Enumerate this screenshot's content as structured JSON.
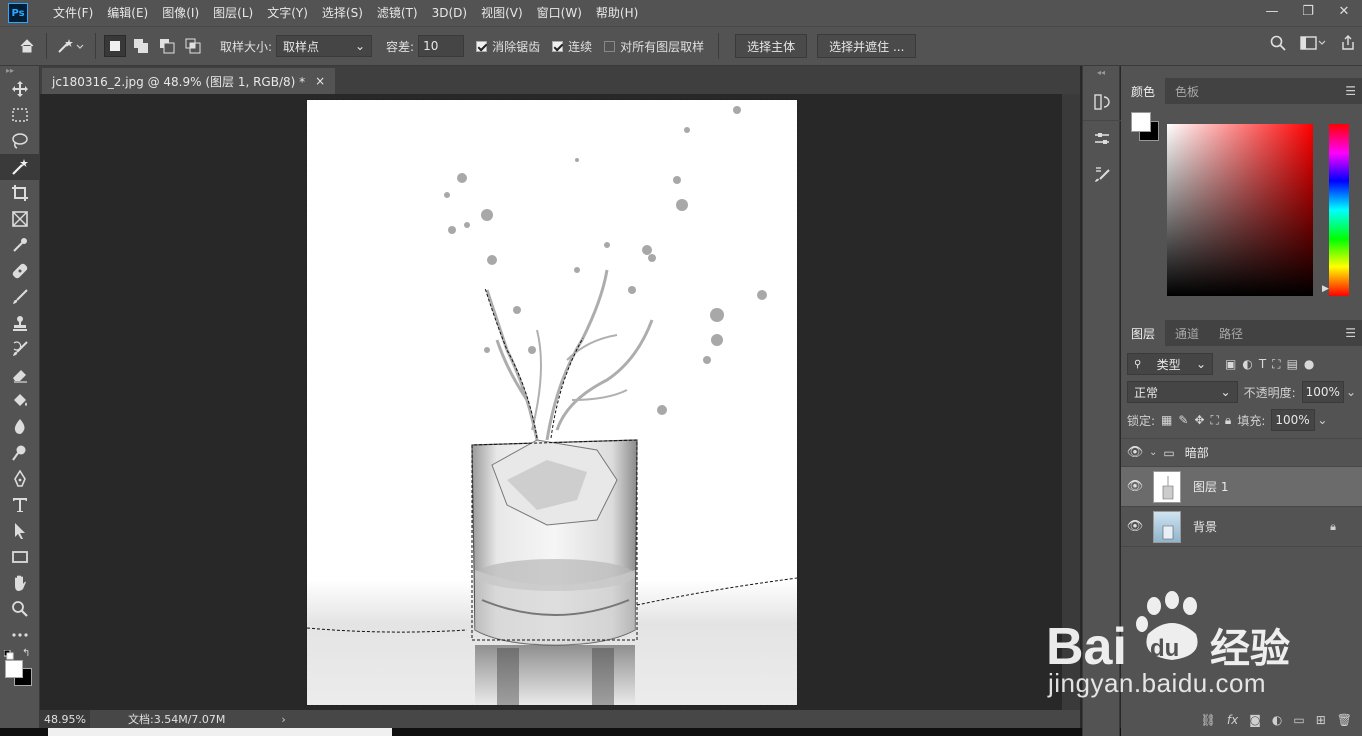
{
  "app": {
    "logo": "Ps"
  },
  "menu": [
    "文件(F)",
    "编辑(E)",
    "图像(I)",
    "图层(L)",
    "文字(Y)",
    "选择(S)",
    "滤镜(T)",
    "3D(D)",
    "视图(V)",
    "窗口(W)",
    "帮助(H)"
  ],
  "window_controls": {
    "minimize": "—",
    "restore": "❐",
    "close": "✕"
  },
  "options": {
    "sample_size_label": "取样大小:",
    "sample_size_value": "取样点",
    "tolerance_label": "容差:",
    "tolerance_value": "10",
    "antialias_label": "消除锯齿",
    "antialias_checked": true,
    "contiguous_label": "连续",
    "contiguous_checked": true,
    "sample_all_label": "对所有图层取样",
    "sample_all_checked": false,
    "select_subject": "选择主体",
    "select_mask": "选择并遮住 ..."
  },
  "document": {
    "tab_title": "jc180316_2.jpg @ 48.9% (图层 1, RGB/8) *",
    "close": "×"
  },
  "status": {
    "zoom": "48.95%",
    "doc_info": "文档:3.54M/7.07M",
    "arrow": "›"
  },
  "tools": [
    "move-tool",
    "marquee-tool",
    "lasso-tool",
    "magic-wand-tool",
    "crop-tool",
    "frame-tool",
    "eyedropper-tool",
    "healing-tool",
    "brush-tool",
    "stamp-tool",
    "history-brush-tool",
    "eraser-tool",
    "paint-bucket-tool",
    "blur-tool",
    "dodge-tool",
    "pen-tool",
    "type-tool",
    "path-select-tool",
    "rectangle-tool",
    "hand-tool",
    "zoom-tool",
    "more-tools"
  ],
  "color_panel": {
    "tabs": [
      "颜色",
      "色板"
    ],
    "foreground": "#ffffff",
    "background": "#000000"
  },
  "layers_panel": {
    "tabs": [
      "图层",
      "通道",
      "路径"
    ],
    "filter_kind": "类型",
    "blend_mode": "正常",
    "opacity_label": "不透明度:",
    "opacity_value": "100%",
    "lock_label": "锁定:",
    "fill_label": "填充:",
    "fill_value": "100%",
    "layers": [
      {
        "name": "暗部",
        "type": "group"
      },
      {
        "name": "图层 1",
        "type": "layer",
        "selected": true
      },
      {
        "name": "背景",
        "type": "background",
        "locked": true
      }
    ],
    "footer": {
      "fx": "fx"
    }
  },
  "watermark": {
    "logo": "Bai du 经验",
    "url": "jingyan.baidu.com"
  }
}
